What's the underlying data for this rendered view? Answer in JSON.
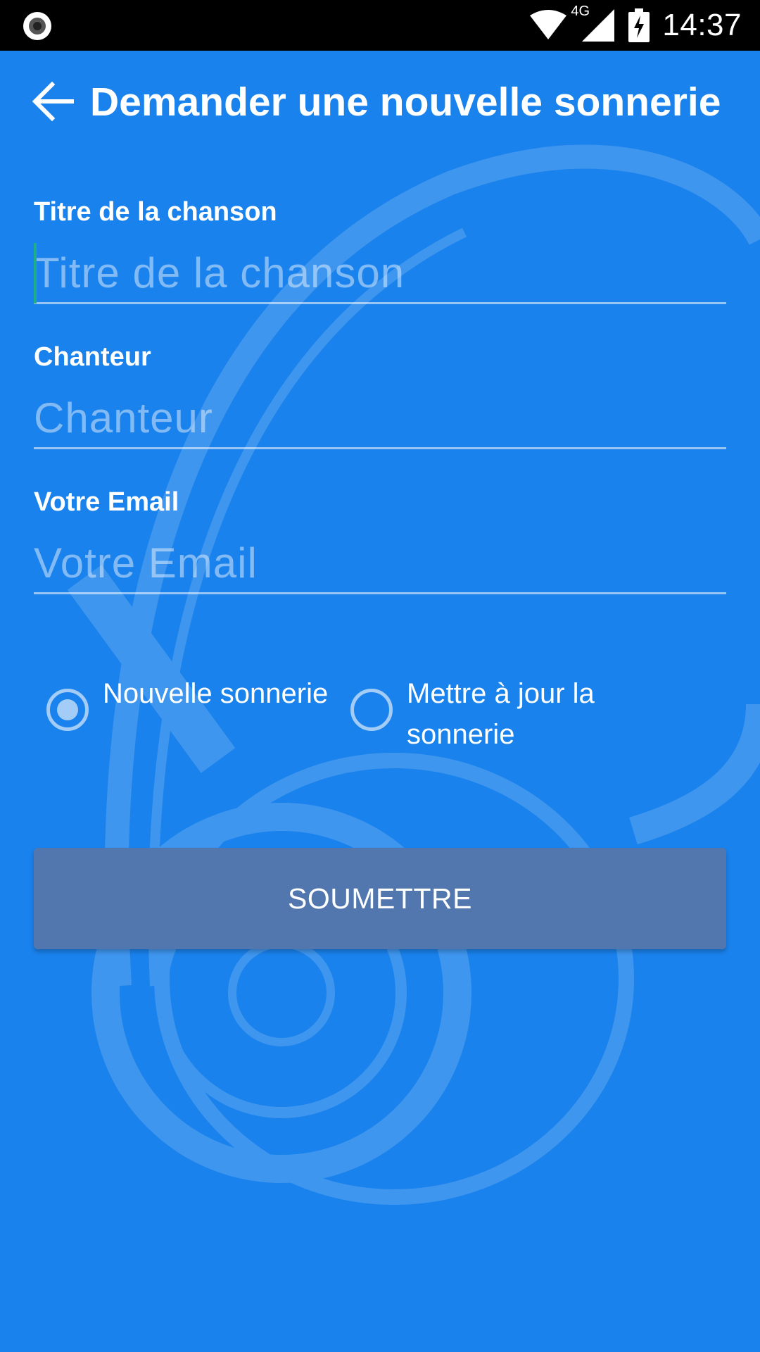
{
  "status_bar": {
    "time": "14:37",
    "network_type": "4G",
    "icons": [
      "screen-record-icon",
      "wifi-icon",
      "cell-signal-icon",
      "battery-charging-icon"
    ]
  },
  "app_bar": {
    "title": "Demander une nouvelle sonnerie",
    "back_icon": "arrow-left-icon"
  },
  "form": {
    "song_title": {
      "label": "Titre de la chanson",
      "placeholder": "Titre de la chanson",
      "value": ""
    },
    "singer": {
      "label": "Chanteur",
      "placeholder": "Chanteur",
      "value": ""
    },
    "email": {
      "label": "Votre Email",
      "placeholder": "Votre Email",
      "value": ""
    },
    "request_type": {
      "options": [
        {
          "label": "Nouvelle sonnerie",
          "checked": true
        },
        {
          "label": "Mettre à jour la sonnerie",
          "checked": false
        }
      ]
    },
    "submit_label": "SOUMETTRE"
  },
  "colors": {
    "background": "#1a82ec",
    "status_bar": "#000000",
    "button": "#5277ae",
    "text": "#ffffff",
    "caret": "#1fae8a"
  }
}
